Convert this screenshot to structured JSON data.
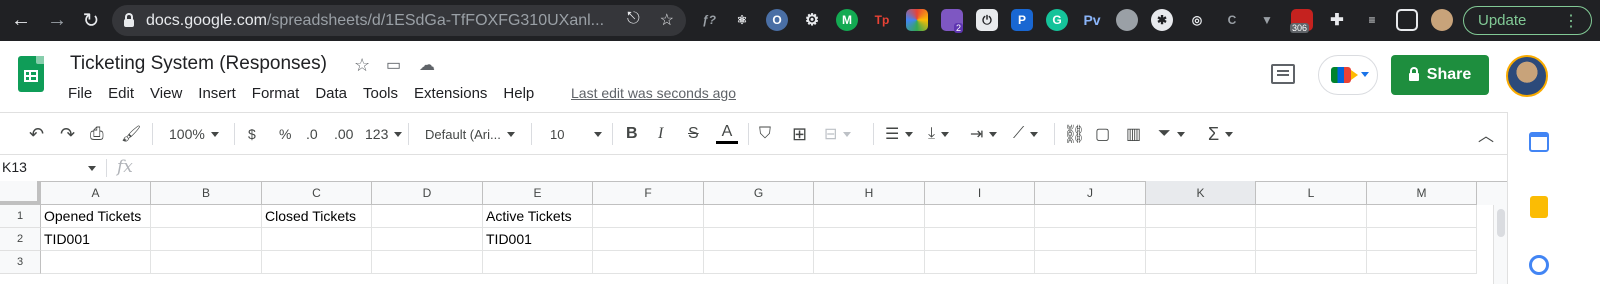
{
  "browser": {
    "url_host": "docs.google.com",
    "url_path": "/spreadsheets/d/1ESdGa-TfFOXFG310UXanl...",
    "extension_badges": [
      "2",
      "306"
    ],
    "update_label": "Update"
  },
  "doc": {
    "title": "Ticketing System (Responses)",
    "menu": [
      "File",
      "Edit",
      "View",
      "Insert",
      "Format",
      "Data",
      "Tools",
      "Extensions",
      "Help"
    ],
    "last_edit": "Last edit was seconds ago",
    "share_label": "Share"
  },
  "toolbar": {
    "zoom": "100%",
    "currency": "$",
    "percent": "%",
    "decrease_decimal": ".0",
    "increase_decimal": ".00",
    "more_formats": "123",
    "font": "Default (Ari...",
    "font_size": "10",
    "bold": "B",
    "italic": "I",
    "strike": "S",
    "text_color": "A"
  },
  "formula_bar": {
    "name_box": "K13",
    "fx": "fx"
  },
  "grid": {
    "columns": [
      "A",
      "B",
      "C",
      "D",
      "E",
      "F",
      "G",
      "H",
      "I",
      "J",
      "K",
      "L",
      "M"
    ],
    "selected_column": "K",
    "rows": [
      "1",
      "2",
      "3"
    ],
    "cells": {
      "A1": "Opened Tickets",
      "C1": "Closed Tickets",
      "E1": "Active Tickets",
      "A2": "TID001",
      "E2": "TID001"
    }
  },
  "colors": {
    "share_green": "#1e8e3e",
    "chrome_bg": "#202124",
    "update_green": "#81c995"
  }
}
